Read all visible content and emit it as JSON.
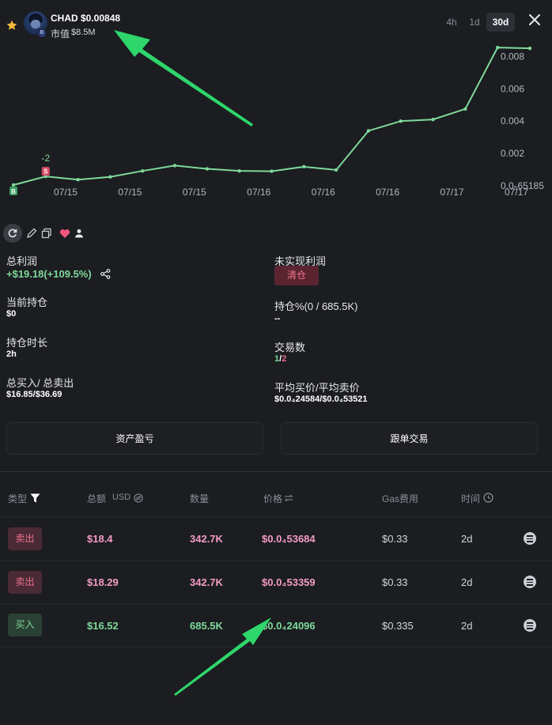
{
  "header": {
    "token_symbol": "CHAD",
    "token_price": "$0.00848",
    "market_cap_label": "市值",
    "market_cap_value": "$8.5M",
    "chain_badge": "B",
    "timeframes": [
      "4h",
      "1d",
      "30d"
    ],
    "active_timeframe": "30d"
  },
  "chart_data": {
    "type": "line",
    "x_labels": [
      "07/15",
      "07/15",
      "07/15",
      "07/16",
      "07/16",
      "07/16",
      "07/17",
      "07/17"
    ],
    "y_tick_labels": [
      "0.008",
      "0.006",
      "0.004",
      "0.002",
      "0.0₅65185"
    ],
    "y_ticks": [
      0.008,
      0.006,
      0.004,
      0.002,
      6.5185e-06
    ],
    "ylim": [
      0,
      0.0088
    ],
    "values": [
      5e-05,
      0.00058,
      0.00038,
      0.00055,
      0.00092,
      0.00125,
      0.00105,
      0.00092,
      0.0009,
      0.00118,
      0.00098,
      0.0034,
      0.004,
      0.0041,
      0.00475,
      0.00855,
      0.0085
    ],
    "series_color": "#7fd99a",
    "grid": false,
    "markers": [
      {
        "type": "buy",
        "label": "B",
        "index": 0
      },
      {
        "type": "sell",
        "label": "S",
        "index": 1,
        "annotation": "-2"
      }
    ]
  },
  "toolbar": {
    "icons": [
      "refresh-icon",
      "edit-icon",
      "copy-icon",
      "heart-icon",
      "user-icon"
    ]
  },
  "stats": {
    "total_profit_label": "总利润",
    "total_profit_value": "+$19.18(+109.5%)",
    "unrealized_label": "未实现利润",
    "clear_label": "清仓",
    "holding_label": "当前持仓",
    "holding_value": "$0",
    "holding_pct_label": "持仓%(0 / 685.5K)",
    "holding_pct_value": "--",
    "duration_label": "持仓时长",
    "duration_value": "2h",
    "trades_label": "交易数",
    "trades_buy": "1",
    "trades_sep": "/",
    "trades_sell": "2",
    "buy_sell_label": "总买入/ 总卖出",
    "buy_sell_value": "$16.85/$36.69",
    "avg_price_label": "平均买价/平均卖价",
    "avg_price_value": "$0.0₄24584/$0.0₄53521"
  },
  "buttons": {
    "asset_pnl": "资产盈亏",
    "copy_trade": "跟单交易"
  },
  "table": {
    "headers": {
      "type": "类型",
      "amount": "总额",
      "amount_unit": "USD",
      "quantity": "数量",
      "price": "价格",
      "gas": "Gas费用",
      "time": "时间"
    },
    "rows": [
      {
        "type": "卖出",
        "side": "sell",
        "amount": "$18.4",
        "quantity": "342.7K",
        "price": "$0.0₄53684",
        "gas": "$0.33",
        "time": "2d"
      },
      {
        "type": "卖出",
        "side": "sell",
        "amount": "$18.29",
        "quantity": "342.7K",
        "price": "$0.0₄53359",
        "gas": "$0.33",
        "time": "2d"
      },
      {
        "type": "买入",
        "side": "buy",
        "amount": "$16.52",
        "quantity": "685.5K",
        "price": "$0.0₄24096",
        "gas": "$0.335",
        "time": "2d"
      }
    ]
  },
  "colors": {
    "background": "#1b1d21",
    "positive": "#7fd99a",
    "negative": "#f0718a",
    "arrow": "#2fd66b"
  }
}
